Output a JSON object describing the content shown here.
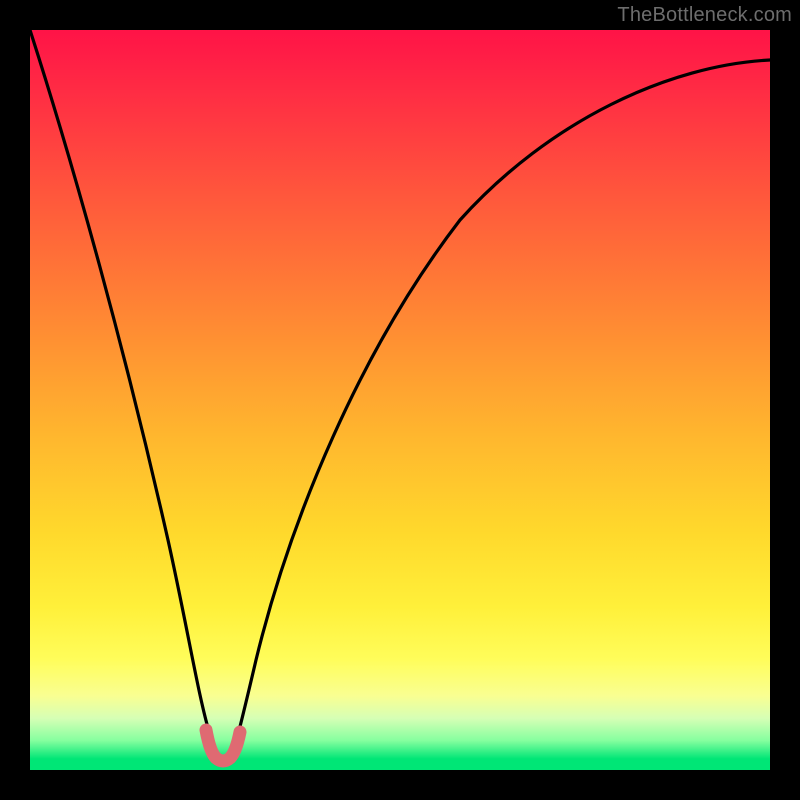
{
  "watermark": "TheBottleneck.com",
  "chart_data": {
    "type": "line",
    "title": "",
    "xlabel": "",
    "ylabel": "",
    "xlim": [
      0,
      100
    ],
    "ylim": [
      0,
      100
    ],
    "series": [
      {
        "name": "curve",
        "x": [
          0,
          4,
          8,
          12,
          15,
          18,
          20,
          22,
          23.5,
          25,
          26,
          27,
          28,
          30,
          33,
          37,
          42,
          48,
          55,
          62,
          70,
          78,
          86,
          93,
          100
        ],
        "y": [
          100,
          79,
          60,
          43,
          31,
          20,
          14,
          8,
          3,
          1,
          0.5,
          1,
          3,
          10,
          20,
          32,
          45,
          57,
          67,
          75,
          82,
          86,
          90,
          92.5,
          94
        ]
      }
    ],
    "highlight_region": {
      "name": "min-marker",
      "color": "#e06a70",
      "x": [
        23.5,
        28.5
      ],
      "y": [
        0.5,
        4
      ]
    },
    "background_gradient": {
      "top": "#ff1347",
      "mid": "#ffd92c",
      "bottom": "#00e676"
    }
  }
}
